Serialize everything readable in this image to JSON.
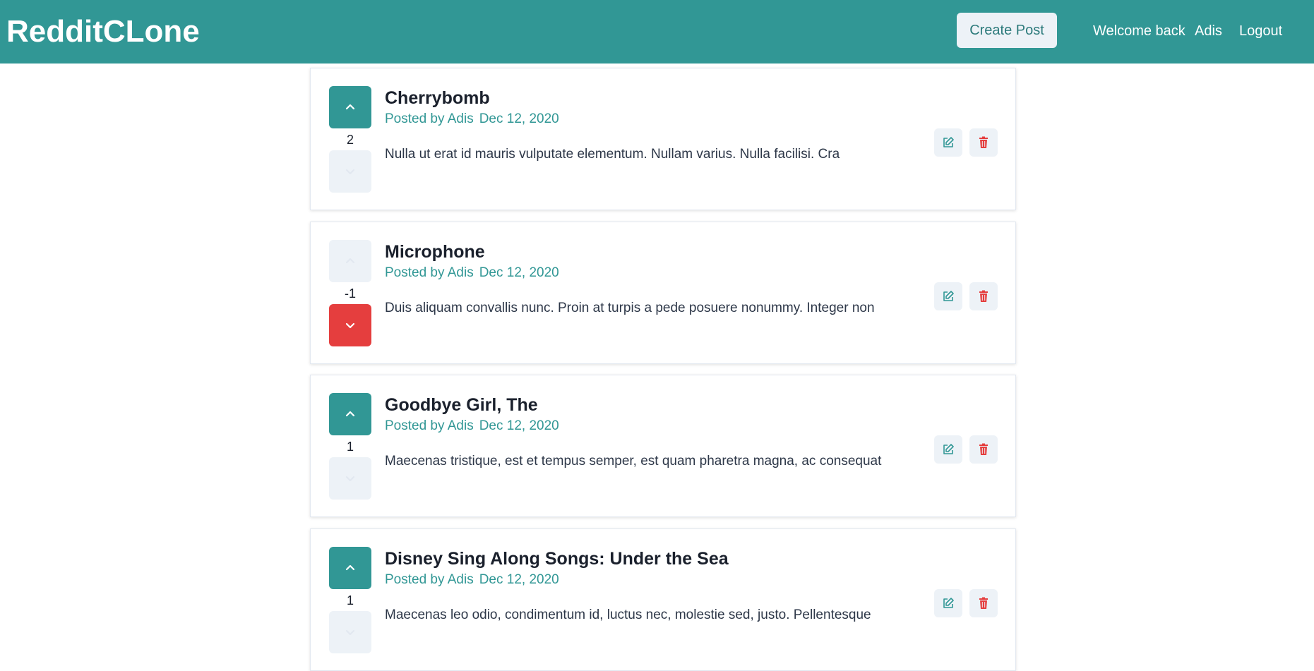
{
  "header": {
    "brand": "RedditCLone",
    "create_post_label": "Create Post",
    "welcome_text": "Welcome back",
    "username": "Adis",
    "logout_label": "Logout"
  },
  "colors": {
    "brand": "#319795",
    "downvote_active": "#e53e3e",
    "delete_icon": "#e53e3e",
    "button_bg": "#edf2f7"
  },
  "posts": [
    {
      "title": "Cherrybomb",
      "posted_by": "Posted by Adis",
      "date": "Dec 12, 2020",
      "body": "Nulla ut erat id mauris vulputate elementum. Nullam varius. Nulla facilisi. Cra",
      "vote_count": "2",
      "vote_state": "up"
    },
    {
      "title": "Microphone",
      "posted_by": "Posted by Adis",
      "date": "Dec 12, 2020",
      "body": "Duis aliquam convallis nunc. Proin at turpis a pede posuere nonummy. Integer non",
      "vote_count": "-1",
      "vote_state": "down"
    },
    {
      "title": "Goodbye Girl, The",
      "posted_by": "Posted by Adis",
      "date": "Dec 12, 2020",
      "body": "Maecenas tristique, est et tempus semper, est quam pharetra magna, ac consequat",
      "vote_count": "1",
      "vote_state": "up"
    },
    {
      "title": "Disney Sing Along Songs: Under the Sea",
      "posted_by": "Posted by Adis",
      "date": "Dec 12, 2020",
      "body": "Maecenas leo odio, condimentum id, luctus nec, molestie sed, justo. Pellentesque",
      "vote_count": "1",
      "vote_state": "up"
    }
  ]
}
